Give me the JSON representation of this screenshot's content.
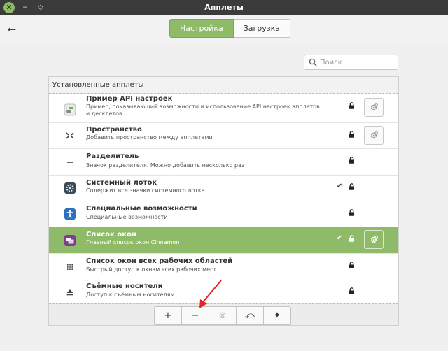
{
  "window": {
    "title": "Апплеты",
    "close_glyph": "✕",
    "minimize_glyph": "‒",
    "maximize_glyph": "◇"
  },
  "header": {
    "back_glyph": "←",
    "tabs": [
      {
        "label": "Настройка",
        "active": true
      },
      {
        "label": "Загрузка",
        "active": false
      }
    ]
  },
  "search": {
    "placeholder": "Поиск",
    "value": ""
  },
  "section": {
    "title": "Установленные апплеты"
  },
  "applets": [
    {
      "name": "Пример API настроек",
      "description": "Пример, показывающий возможности и использование API настроек апплетов и десклетов",
      "icon": "settings-example-icon",
      "locked": true,
      "enabled": false,
      "configurable": true,
      "selected": false
    },
    {
      "name": "Пространство",
      "description": "Добавить пространство между апплетами",
      "icon": "spacer-icon",
      "locked": true,
      "enabled": false,
      "configurable": true,
      "selected": false
    },
    {
      "name": "Разделитель",
      "description": "Значок разделителя. Можно добавить несколько раз",
      "icon": "separator-icon",
      "locked": true,
      "enabled": false,
      "configurable": false,
      "selected": false
    },
    {
      "name": "Системный лоток",
      "description": "Содержит все значки системного лотка",
      "icon": "systray-icon",
      "locked": true,
      "enabled": true,
      "configurable": false,
      "selected": false
    },
    {
      "name": "Специальные возможности",
      "description": "Специальные возможности",
      "icon": "accessibility-icon",
      "locked": true,
      "enabled": false,
      "configurable": false,
      "selected": false
    },
    {
      "name": "Список окон",
      "description": "Главный список окон Cinnamon",
      "icon": "window-list-icon",
      "locked": true,
      "enabled": true,
      "configurable": true,
      "selected": true
    },
    {
      "name": "Список окон всех рабочих областей",
      "description": "Быстрый доступ к окнам всех рабочих мест",
      "icon": "workspace-window-list-icon",
      "locked": true,
      "enabled": false,
      "configurable": false,
      "selected": false
    },
    {
      "name": "Съёмные носители",
      "description": "Доступ к съёмным носителям",
      "icon": "eject-icon",
      "locked": true,
      "enabled": false,
      "configurable": false,
      "selected": false
    }
  ],
  "toolbar": {
    "buttons": [
      {
        "name": "add-button",
        "glyph": "+",
        "disabled": false
      },
      {
        "name": "remove-button",
        "glyph": "−",
        "disabled": false
      },
      {
        "name": "uninstall-button",
        "glyph": "⊗",
        "disabled": true
      },
      {
        "name": "restore-button",
        "glyph": "⤺",
        "disabled": false
      },
      {
        "name": "more-button",
        "glyph": "✦",
        "disabled": false
      }
    ]
  },
  "colors": {
    "accent": "#8fba68",
    "titlebar": "#3b3b3b",
    "annotation": "#e8231f"
  },
  "check_glyph": "✔"
}
